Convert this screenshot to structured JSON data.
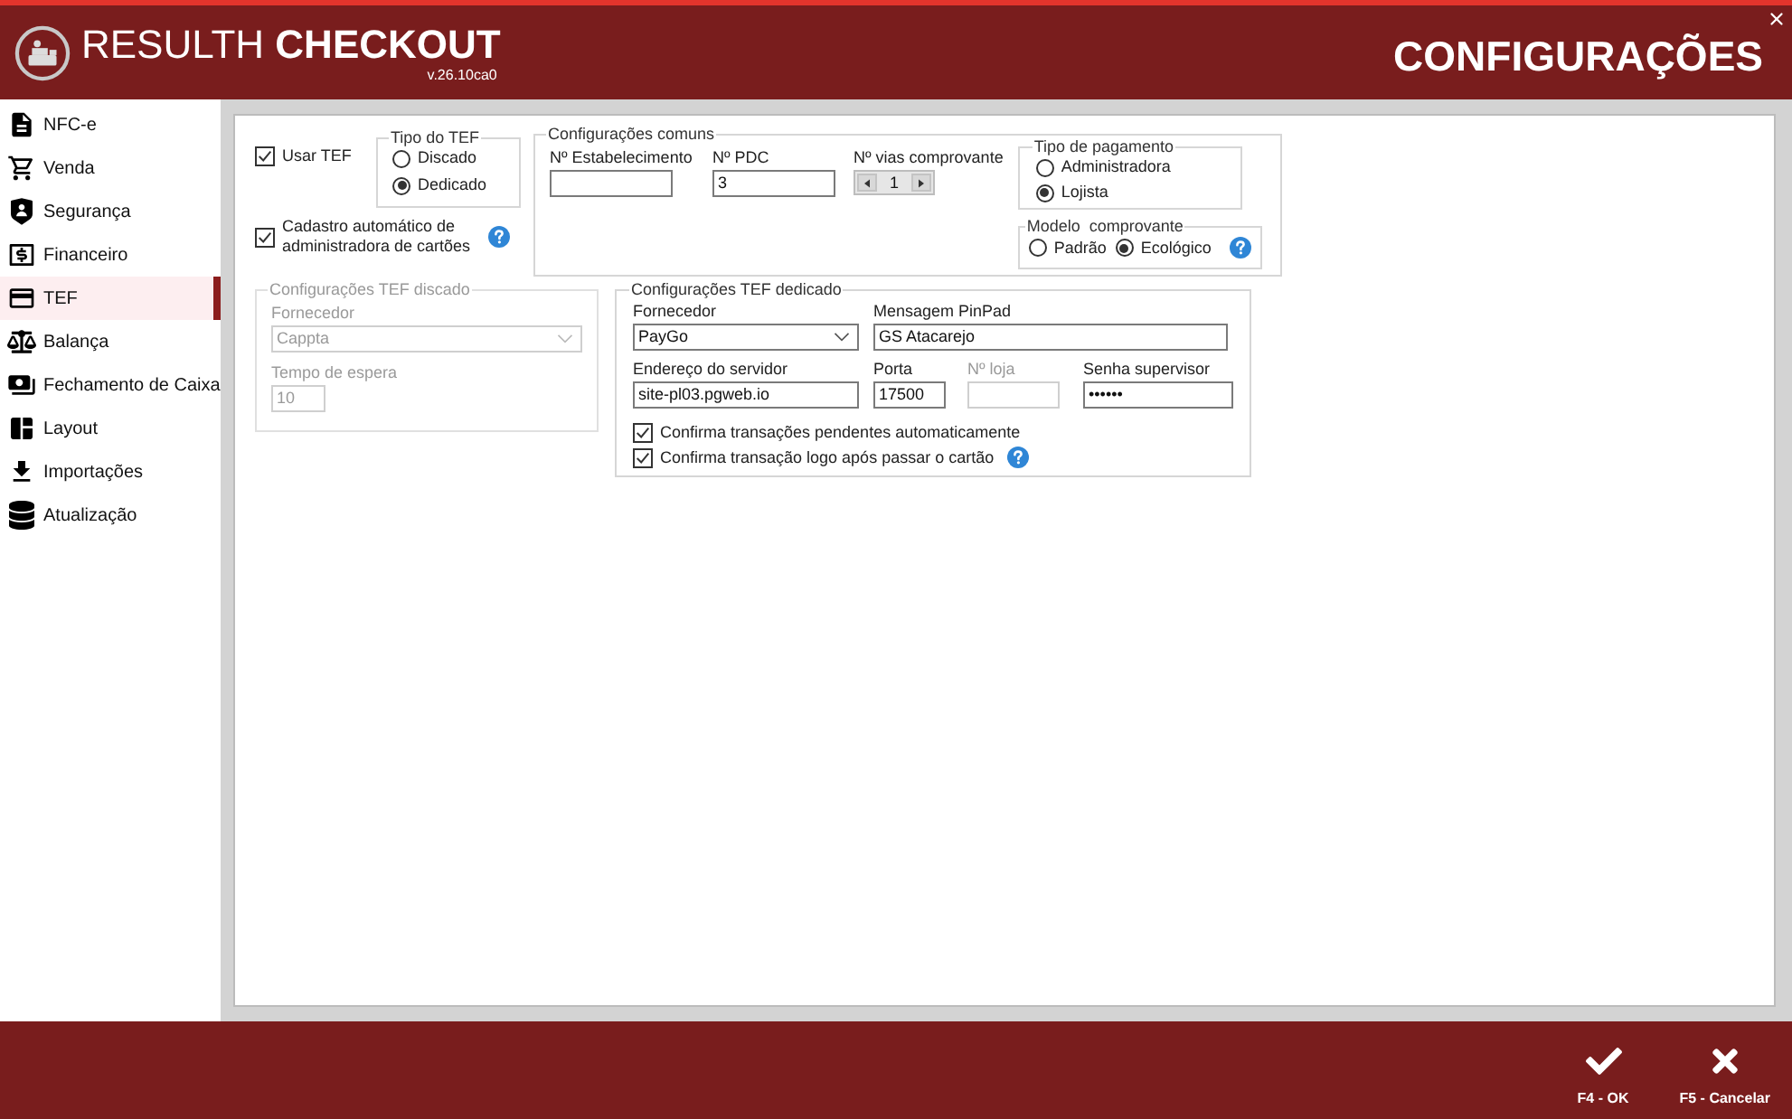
{
  "header": {
    "app_name": "RESULTH **CHECKOUT**",
    "version": "v.26.10ca0",
    "title": "CONFIGURAÇÕES"
  },
  "sidebar": {
    "items": [
      {
        "label": "NFC-e",
        "selected": false
      },
      {
        "label": "Venda",
        "selected": false
      },
      {
        "label": "Segurança",
        "selected": false
      },
      {
        "label": "Financeiro",
        "selected": false
      },
      {
        "label": "TEF",
        "selected": true
      },
      {
        "label": "Balança",
        "selected": false
      },
      {
        "label": "Fechamento de Caixa",
        "selected": false
      },
      {
        "label": "Layout",
        "selected": false
      },
      {
        "label": "Importações",
        "selected": false
      },
      {
        "label": "Atualização",
        "selected": false
      }
    ]
  },
  "tef": {
    "use_tef": {
      "label": "Usar TEF",
      "checked": true
    },
    "tef_type": {
      "title": "Tipo do TEF",
      "options": [
        {
          "label": "Discado",
          "selected": false
        },
        {
          "label": "Dedicado",
          "selected": true
        }
      ]
    },
    "auto_register": {
      "label": "Cadastro automático de administradora de cartões",
      "checked": true,
      "help": true
    },
    "common": {
      "title": "Configurações comuns",
      "establishment": {
        "label": "Nº Estabelecimento"
      },
      "pdc": {
        "label": "Nº PDC",
        "value": "3"
      },
      "copies": {
        "label": "Nº vias comprovante",
        "value": "1"
      },
      "payment_type": {
        "title": "Tipo de pagamento",
        "options": [
          {
            "label": "Administradora",
            "selected": false
          },
          {
            "label": "Lojista",
            "selected": true
          }
        ]
      },
      "receipt_model": {
        "title": "Modelo  comprovante",
        "help": true,
        "options": [
          {
            "label": "Padrão",
            "selected": false
          },
          {
            "label": "Ecológico",
            "selected": true
          }
        ]
      }
    },
    "dialed": {
      "title": "Configurações TEF discado",
      "disabled": true,
      "supplier": {
        "label": "Fornecedor",
        "value": "Cappta"
      },
      "timeout": {
        "label": "Tempo de espera",
        "value": "10"
      }
    },
    "dedicated": {
      "title": "Configurações TEF dedicado",
      "supplier": {
        "label": "Fornecedor",
        "value": "PayGo"
      },
      "pinpad_message": {
        "label": "Mensagem PinPad",
        "value": "GS Atacarejo"
      },
      "server": {
        "label": "Endereço do servidor",
        "value": "site-pl03.pgweb.io"
      },
      "port": {
        "label": "Porta",
        "value": "17500"
      },
      "store": {
        "label": "Nº loja",
        "disabled": true
      },
      "supervisor_password": {
        "label": "Senha supervisor",
        "value": "••••••"
      },
      "checkboxes": [
        {
          "label": "Confirma transações pendentes automaticamente",
          "checked": true,
          "help": false
        },
        {
          "label": "Confirma transação logo após passar o cartão",
          "checked": true,
          "help": true
        }
      ]
    }
  },
  "footer": {
    "buttons": [
      {
        "label": "F4 - OK",
        "kind": "confirm"
      },
      {
        "label": "F5 - Cancelar",
        "kind": "cancel"
      }
    ]
  }
}
